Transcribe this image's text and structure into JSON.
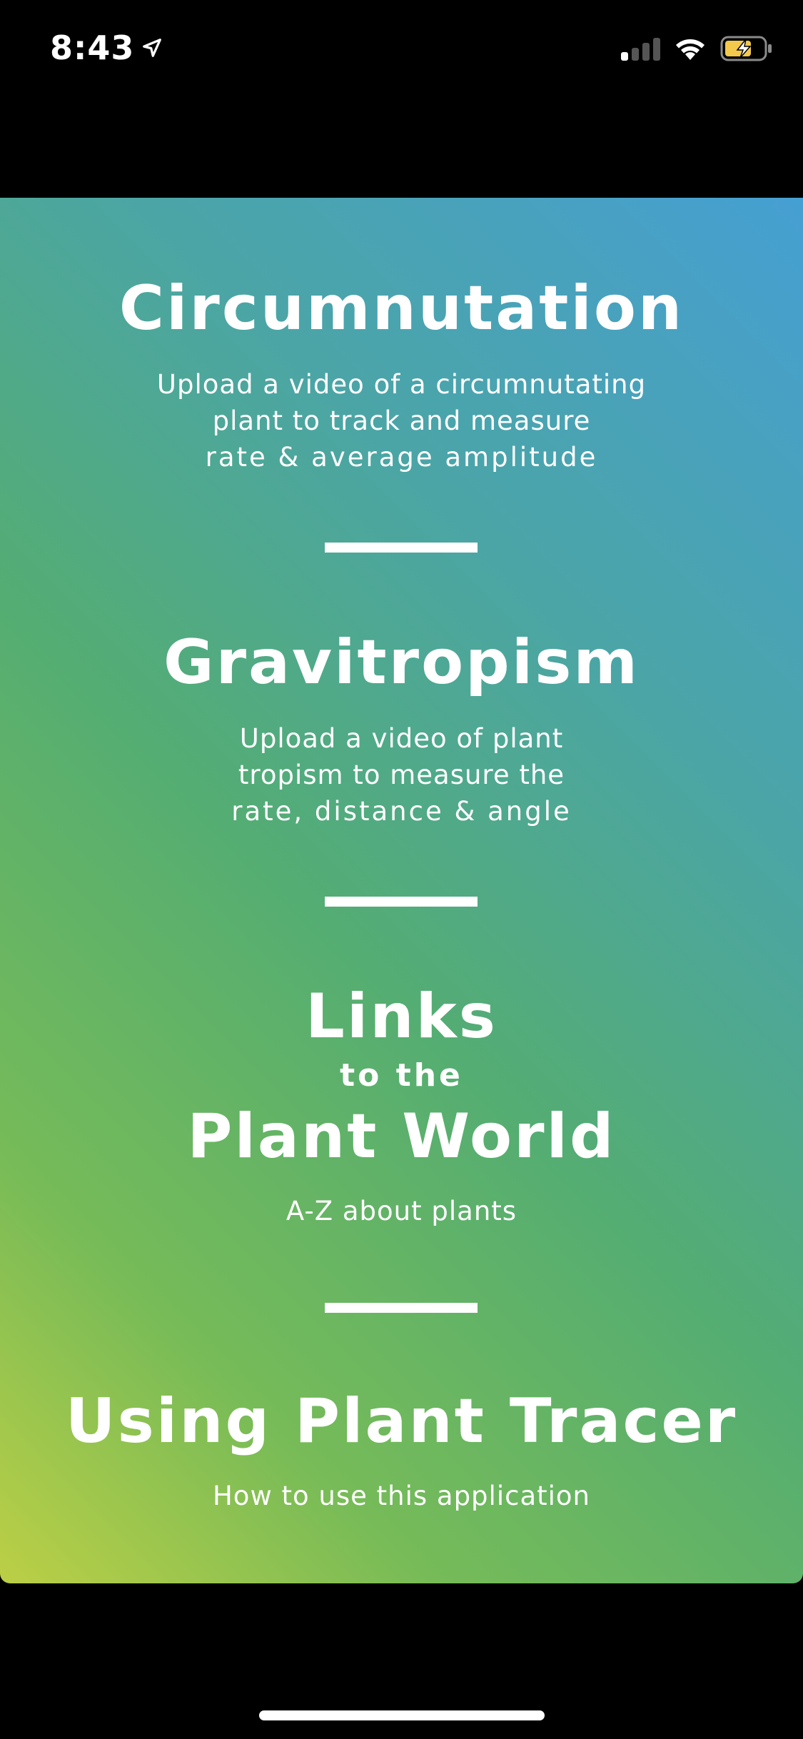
{
  "status_bar": {
    "time": "8:43",
    "location_icon": "location-arrow-icon",
    "signal_icon": "cellular-signal-icon",
    "signal_bars_active": 1,
    "signal_bars_total": 4,
    "wifi_icon": "wifi-icon",
    "battery_icon": "battery-charging-icon",
    "battery_color": "#f2c94c"
  },
  "panel": {
    "gradient_colors": [
      "#469fd2",
      "#4ba5a6",
      "#54ad72",
      "#76bb58",
      "#bccf45"
    ]
  },
  "sections": {
    "circumnutation": {
      "title": "Circumnutation",
      "desc_line1": "Upload a video of a circumnutating",
      "desc_line2": "plant to track and measure",
      "desc_line3": "rate & average amplitude"
    },
    "gravitropism": {
      "title": "Gravitropism",
      "desc_line1": "Upload a video of plant",
      "desc_line2": "tropism to measure the",
      "desc_line3": "rate, distance & angle"
    },
    "links": {
      "title_line1": "Links",
      "title_line2": "to the",
      "title_line3": "Plant World",
      "desc": "A-Z about plants"
    },
    "using": {
      "title": "Using Plant Tracer",
      "desc": "How to use this application"
    }
  }
}
